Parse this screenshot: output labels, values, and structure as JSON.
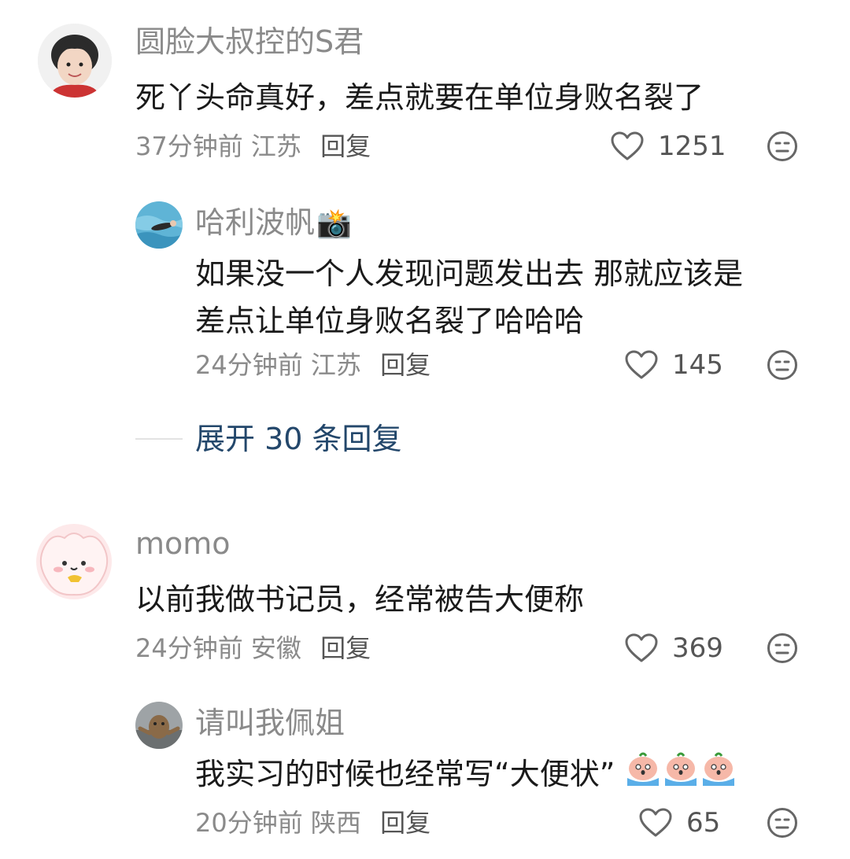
{
  "comments": [
    {
      "username": "圆脸大叔控的S君",
      "content": "死丫头命真好，差点就要在单位身败名裂了",
      "time": "37分钟前",
      "location": "江苏",
      "reply_label": "回复",
      "likes": "1251",
      "replies": [
        {
          "username": "哈利波帆",
          "username_emoji": "📸",
          "content_lines": [
            "如果没一个人发现问题发出去 那就应该是",
            "差点让单位身败名裂了哈哈哈"
          ],
          "time": "24分钟前",
          "location": "江苏",
          "reply_label": "回复",
          "likes": "145"
        }
      ],
      "expand_label": "展开 30 条回复"
    },
    {
      "username": "momo",
      "content": "以前我做书记员，经常被告大便称",
      "time": "24分钟前",
      "location": "安徽",
      "reply_label": "回复",
      "likes": "369",
      "replies": [
        {
          "username": "请叫我佩姐",
          "content": "我实习的时候也经常写“大便状”",
          "sticker_icons": [
            "crying-peach-sticker-icon",
            "crying-peach-sticker-icon",
            "crying-peach-sticker-icon"
          ],
          "time": "20分钟前",
          "location": "陕西",
          "reply_label": "回复",
          "likes": "65"
        }
      ]
    }
  ],
  "colors": {
    "username": "#8a8a8a",
    "content": "#1a1a1a",
    "expand_link": "#23476b"
  }
}
